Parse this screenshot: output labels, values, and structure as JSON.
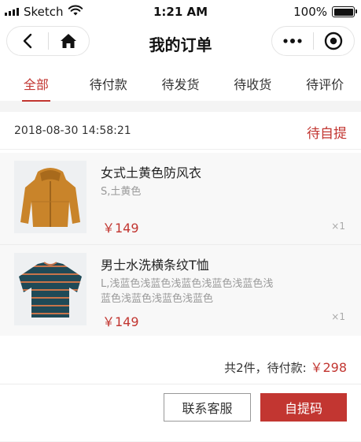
{
  "status_bar": {
    "carrier": "Sketch",
    "time": "1:21 AM",
    "battery": "100%",
    "battery_level": 1.0
  },
  "nav": {
    "title": "我的订单",
    "icons": [
      "back-arrow-icon",
      "home-icon",
      "more-dots-icon",
      "target-circle-icon"
    ]
  },
  "tabs": [
    {
      "label": "全部",
      "active": true
    },
    {
      "label": "待付款",
      "active": false
    },
    {
      "label": "待发货",
      "active": false
    },
    {
      "label": "待收货",
      "active": false
    },
    {
      "label": "待评价",
      "active": false
    }
  ],
  "order": {
    "time": "2018-08-30 14:58:21",
    "status": "待自提",
    "products": [
      {
        "name": "女式土黄色防风衣",
        "spec": "S,土黄色",
        "price": "￥149",
        "qty": "×1"
      },
      {
        "name": "男士水洗横条纹T恤",
        "spec": "L,浅蓝色浅蓝色浅蓝色浅蓝色浅蓝色浅蓝色浅蓝色浅蓝色浅蓝色",
        "price": "￥149",
        "qty": "×1"
      }
    ],
    "summary_prefix": "共2件，待付款:",
    "summary_total": "￥298",
    "buttons": {
      "service": "联系客服",
      "pickup": "自提码"
    }
  },
  "colors": {
    "accent": "#c23631",
    "background": "#f4f4f4"
  }
}
